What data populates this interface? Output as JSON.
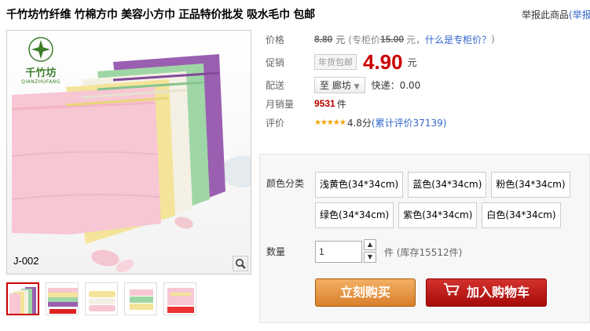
{
  "product": {
    "title": "千竹坊竹纤维 竹棉方巾 美容小方巾 正品特价批发 吸水毛巾 包邮",
    "report_text": "举报此商品",
    "report_link": "(举报"
  },
  "image": {
    "brand_name": "千竹坊",
    "brand_sub": "QIANZHUFANG",
    "code": "J-002",
    "zoom_icon": "magnifier-icon",
    "towel_colors": [
      "#9a5fb0",
      "#9fd6a6",
      "#f4f0e4",
      "#f3e49a",
      "#f7c7d4"
    ],
    "thumbnails": [
      {
        "selected": true
      },
      {
        "selected": false
      },
      {
        "selected": false
      },
      {
        "selected": false
      },
      {
        "selected": false
      }
    ]
  },
  "price": {
    "label": "价格",
    "original": "8.80",
    "unit": "元",
    "counter_text": "(专柜价",
    "counter_price": "15.00",
    "counter_suffix": "元，",
    "counter_link": "什么是专柜价？",
    "counter_close": ")"
  },
  "promo": {
    "label": "促销",
    "tag": "年货包邮",
    "price": "4.90",
    "unit": "元"
  },
  "shipping": {
    "label": "配送",
    "destination": "至 廊坊",
    "fee": "快递：0.00"
  },
  "sales": {
    "label": "月销量",
    "count": "9531",
    "unit": "件"
  },
  "rating": {
    "label": "评价",
    "stars": "★★★★★",
    "score": "4.8分",
    "review_link": "(累计评价37139)"
  },
  "options": {
    "label": "颜色分类",
    "items": [
      "浅黄色(34*34cm)",
      "蓝色(34*34cm)",
      "粉色(34*34cm)",
      "绿色(34*34cm)",
      "紫色(34*34cm)",
      "白色(34*34cm)"
    ]
  },
  "quantity": {
    "label": "数量",
    "value": "1",
    "unit_text": "件 (库存15512件)"
  },
  "buttons": {
    "buy": "立刻购买",
    "cart": "加入购物车"
  },
  "colors": {
    "price_red": "#cc0000",
    "buy_orange": "#d9802c",
    "cart_red": "#a60b0b",
    "link_blue": "#3366cc"
  }
}
